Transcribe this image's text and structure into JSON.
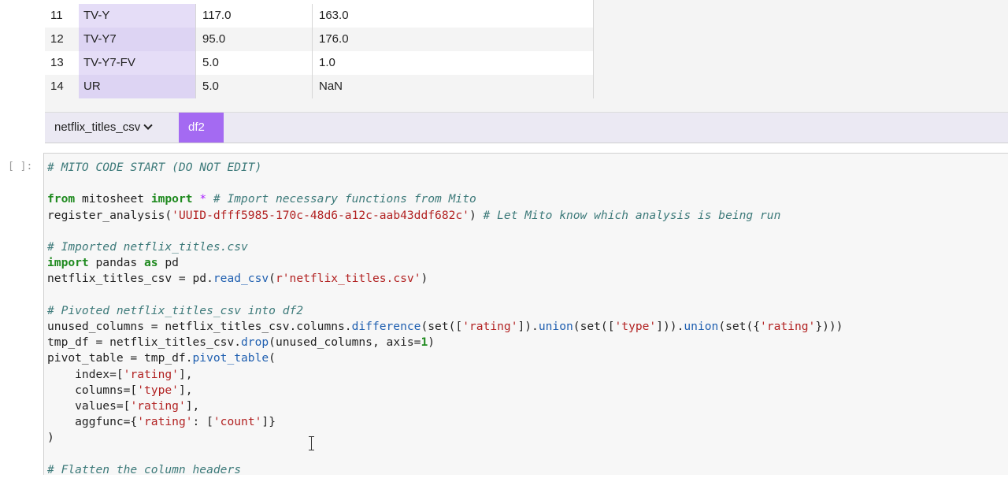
{
  "sheet": {
    "rows": [
      {
        "index": "11",
        "rating": "TV-Y",
        "movie": "117.0",
        "tv": "163.0"
      },
      {
        "index": "12",
        "rating": "TV-Y7",
        "movie": "95.0",
        "tv": "176.0"
      },
      {
        "index": "13",
        "rating": "TV-Y7-FV",
        "movie": "5.0",
        "tv": "1.0"
      },
      {
        "index": "14",
        "rating": "UR",
        "movie": "5.0",
        "tv": "NaN"
      }
    ],
    "tabs": [
      {
        "label": "netflix_titles_csv",
        "active": false
      },
      {
        "label": "df2",
        "active": true
      }
    ],
    "active_tab_color": "#a46af2"
  },
  "code_cell": {
    "prompt": "[ ]:",
    "lines": {
      "l1": "# MITO CODE START (DO NOT EDIT)",
      "l3_kw1": "from",
      "l3_mod": " mitosheet ",
      "l3_kw2": "import",
      "l3_star": " * ",
      "l3_cm": "# Import necessary functions from Mito",
      "l4_a": "register_analysis(",
      "l4_str": "'UUID-dfff5985-170c-48d6-a12c-aab43ddf682c'",
      "l4_b": ") ",
      "l4_cm": "# Let Mito know which analysis is being run",
      "l6": "# Imported netflix_titles.csv",
      "l7_kw1": "import",
      "l7_mid": " pandas ",
      "l7_kw2": "as",
      "l7_end": " pd",
      "l8_a": "netflix_titles_csv = pd.",
      "l8_fn": "read_csv",
      "l8_b": "(",
      "l8_str": "r'netflix_titles.csv'",
      "l8_c": ")",
      "l10": "# Pivoted netflix_titles_csv into df2",
      "l11_a": "unused_columns = netflix_titles_csv.columns.",
      "l11_fn1": "difference",
      "l11_b": "(set([",
      "l11_s1": "'rating'",
      "l11_c": "]).",
      "l11_fn2": "union",
      "l11_d": "(set([",
      "l11_s2": "'type'",
      "l11_e": "])).",
      "l11_fn3": "union",
      "l11_f": "(set({",
      "l11_s3": "'rating'",
      "l11_g": "})))",
      "l12_a": "tmp_df = netflix_titles_csv.",
      "l12_fn": "drop",
      "l12_b": "(unused_columns, axis=",
      "l12_num": "1",
      "l12_c": ")",
      "l13_a": "pivot_table = tmp_df.",
      "l13_fn": "pivot_table",
      "l13_b": "(",
      "l14_a": "    index=[",
      "l14_s": "'rating'",
      "l14_b": "],",
      "l15_a": "    columns=[",
      "l15_s": "'type'",
      "l15_b": "],",
      "l16_a": "    values=[",
      "l16_s": "'rating'",
      "l16_b": "],",
      "l17_a": "    aggfunc={",
      "l17_s1": "'rating'",
      "l17_b": ": [",
      "l17_s2": "'count'",
      "l17_c": "]}",
      "l18": ")",
      "l20": "# Flatten the column headers"
    }
  }
}
